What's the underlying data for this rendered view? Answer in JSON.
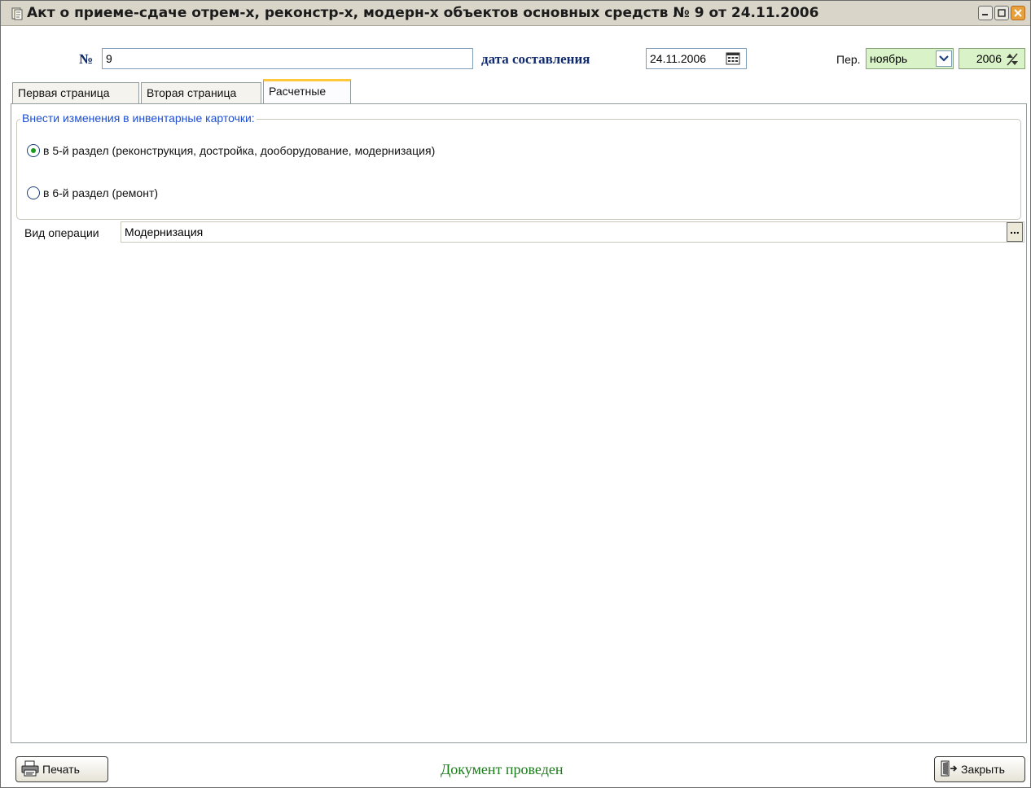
{
  "window": {
    "title": "Акт о приеме-сдаче отрем-х, реконстр-х, модерн-х объектов основных средств № 9 от 24.11.2006",
    "icons": [
      "document-icon",
      "minimize-icon",
      "maximize-icon",
      "close-icon"
    ]
  },
  "header": {
    "number_label": "№",
    "number_value": "9",
    "date_label": "дата составления",
    "date_value": "24.11.2006",
    "period_label": "Пер.",
    "period_month": "ноябрь",
    "period_year": "2006"
  },
  "tabs": [
    {
      "label": "Первая страница"
    },
    {
      "label": "Вторая страница"
    },
    {
      "label": "Расчетные",
      "active": true
    }
  ],
  "group": {
    "title": "Внести изменения в инвентарные карточки:",
    "options": [
      {
        "label": "в 5-й раздел (реконструкция, достройка, дооборудование, модернизация)",
        "checked": true
      },
      {
        "label": "в 6-й раздел (ремонт)",
        "checked": false
      }
    ]
  },
  "operation": {
    "label": "Вид операции",
    "value": "Модернизация",
    "button_label": "..."
  },
  "footer": {
    "print_label": "Печать",
    "status_text": "Документ проведен",
    "close_label": "Закрыть"
  },
  "colors": {
    "accent_tab": "#ffc83c",
    "status_green": "#1a7a1a",
    "group_title_blue": "#1c4ed1",
    "header_label_blue": "#102a6e"
  }
}
